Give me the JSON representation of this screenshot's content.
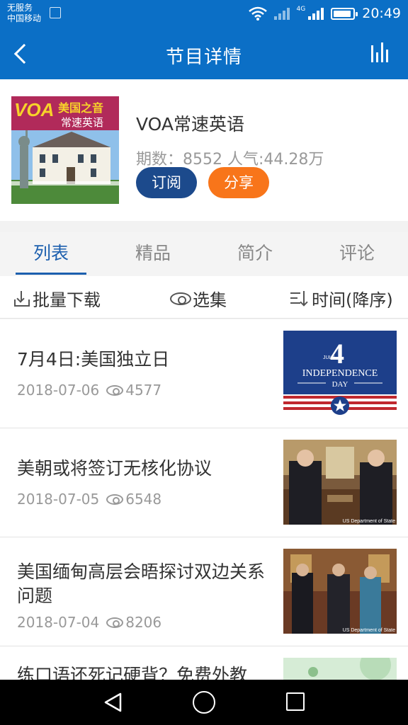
{
  "status_bar": {
    "carrier_line1": "无服务",
    "carrier_line2": "中国移动",
    "network": "4G",
    "time": "20:49"
  },
  "header": {
    "title": "节目详情",
    "back_icon": "back-arrow-icon",
    "stats_icon": "bar-chart-icon"
  },
  "program": {
    "title": "VOA常速英语",
    "meta": "期数：8552 人气:44.28万",
    "subscribe_label": "订阅",
    "share_label": "分享",
    "cover_brand": "VOA",
    "cover_top_text": "美国之音",
    "cover_sub_text": "常速英语"
  },
  "tabs": [
    {
      "label": "列表",
      "active": true
    },
    {
      "label": "精品",
      "active": false
    },
    {
      "label": "简介",
      "active": false
    },
    {
      "label": "评论",
      "active": false
    }
  ],
  "toolbar": {
    "download_label": "批量下载",
    "select_label": "选集",
    "sort_label": "时间(降序)"
  },
  "episodes": [
    {
      "title": "7月4日:美国独立日",
      "date": "2018-07-06",
      "views": "4577",
      "thumb_big": "4",
      "thumb_small": "JULY",
      "thumb_text1": "INDEPENDENCE",
      "thumb_text2": "DAY"
    },
    {
      "title": "美朝或将签订无核化协议",
      "date": "2018-07-05",
      "views": "6548",
      "thumb_caption": "US Department of State"
    },
    {
      "title": "美国缅甸高层会晤探讨双边关系问题",
      "date": "2018-07-04",
      "views": "8206",
      "thumb_caption": "US Department of State"
    },
    {
      "title": "练口语还死记硬背？免费外教"
    }
  ],
  "colors": {
    "primary": "#0b6fc6",
    "tab_active": "#1c5fae",
    "subscribe": "#1c4a8c",
    "share": "#f8751a"
  }
}
